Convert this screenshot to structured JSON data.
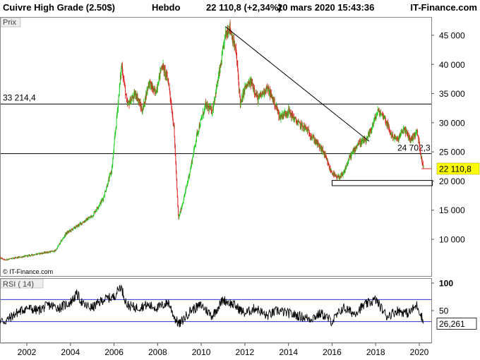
{
  "header": {
    "instrument": "Cuivre High Grade (2.50$)",
    "period": "Hebdo",
    "quote": "22 110,8 (+2,34%)",
    "datetime": "20 mars 2020 15:43:36",
    "site": "IT-Finance.com"
  },
  "price_panel": {
    "label": "Prix",
    "copyright": "© IT-Finance.com",
    "last_price_label": "22 110,8",
    "last_price_color": "#ffff00",
    "candle_up_color": "#22cc22",
    "candle_down_color": "#dd2222"
  },
  "rsi_panel": {
    "label": "RSI ( 14)",
    "value_label": "26,261",
    "levels": [
      70,
      30
    ],
    "level_color": "#3333cc"
  },
  "chart_data": [
    {
      "type": "line",
      "title": "Cuivre High Grade (2.50$)",
      "x_ticks": [
        "2002",
        "2004",
        "2006",
        "2008",
        "2010",
        "2012",
        "2014",
        "2016",
        "2018",
        "2020"
      ],
      "y_ticks": [
        "10 000",
        "15 000",
        "20 000",
        "25 000",
        "30 000",
        "35 000",
        "40 000",
        "45 000"
      ],
      "ylim": [
        5000,
        47500
      ],
      "grid": false,
      "series": [
        {
          "x": [
            2000.0,
            2001.0,
            2001.8,
            2002.5,
            2003.3,
            2003.8,
            2004.2,
            2005.0,
            2005.5,
            2005.9,
            2006.1,
            2006.35,
            2006.6,
            2007.0,
            2007.3,
            2007.6,
            2007.9,
            2008.2,
            2008.5,
            2008.75,
            2008.95,
            2009.2,
            2009.5,
            2009.8,
            2010.2,
            2010.5,
            2010.9,
            2011.1,
            2011.3,
            2011.6,
            2011.8,
            2012.0,
            2012.3,
            2012.6,
            2013.0,
            2013.3,
            2013.6,
            2014.0,
            2014.4,
            2014.8,
            2015.2,
            2015.6,
            2015.9,
            2016.2,
            2016.5,
            2016.8,
            2017.2,
            2017.6,
            2017.9,
            2018.1,
            2018.4,
            2018.7,
            2019.0,
            2019.3,
            2019.6,
            2019.9,
            2020.05,
            2020.2
          ],
          "y": [
            8000,
            6500,
            7000,
            7500,
            8000,
            11000,
            12000,
            14000,
            17000,
            22000,
            30000,
            40000,
            33000,
            35000,
            32000,
            37000,
            35000,
            40000,
            37000,
            29000,
            13500,
            17000,
            22000,
            28000,
            33000,
            32000,
            40000,
            45000,
            46500,
            42000,
            33000,
            36000,
            37000,
            34000,
            36000,
            34000,
            31000,
            32000,
            30000,
            29000,
            27000,
            25000,
            22000,
            20500,
            21000,
            24000,
            26500,
            27000,
            30000,
            32000,
            31000,
            28000,
            27000,
            29000,
            27000,
            28500,
            25000,
            22110.8
          ]
        }
      ],
      "annotations": [
        {
          "text": "33 214,4",
          "type": "horizontal_line",
          "y": 33214.4
        },
        {
          "text": "24 702,3",
          "type": "horizontal_line",
          "y": 24702.3
        },
        {
          "type": "trendline",
          "x1": 2011.1,
          "y1": 46500,
          "x2": 2017.7,
          "y2": 26800
        },
        {
          "type": "rectangle",
          "x1": 2016.0,
          "x2": 2020.6,
          "y1": 19200,
          "y2": 20100
        }
      ]
    },
    {
      "type": "line",
      "title": "RSI ( 14)",
      "y_ticks": [
        "50",
        "100"
      ],
      "ylim": [
        10,
        110
      ],
      "grid": false,
      "series": [
        {
          "x": [
            2000.0,
            2000.5,
            2001.0,
            2001.5,
            2002.0,
            2002.5,
            2003.0,
            2003.5,
            2004.0,
            2004.3,
            2004.6,
            2005.0,
            2005.5,
            2006.0,
            2006.3,
            2006.6,
            2007.0,
            2007.5,
            2008.0,
            2008.5,
            2008.8,
            2009.0,
            2009.5,
            2010.0,
            2010.5,
            2011.0,
            2011.5,
            2012.0,
            2012.5,
            2013.0,
            2013.5,
            2014.0,
            2014.5,
            2015.0,
            2015.5,
            2016.0,
            2016.5,
            2017.0,
            2017.5,
            2018.0,
            2018.5,
            2019.0,
            2019.5,
            2019.9,
            2020.1,
            2020.2
          ],
          "y": [
            40,
            35,
            30,
            45,
            55,
            50,
            60,
            55,
            65,
            80,
            60,
            55,
            70,
            75,
            95,
            60,
            55,
            60,
            55,
            65,
            35,
            25,
            50,
            60,
            40,
            70,
            60,
            45,
            55,
            40,
            50,
            45,
            40,
            35,
            45,
            30,
            55,
            45,
            60,
            70,
            40,
            50,
            45,
            60,
            40,
            26.261
          ]
        }
      ]
    }
  ]
}
